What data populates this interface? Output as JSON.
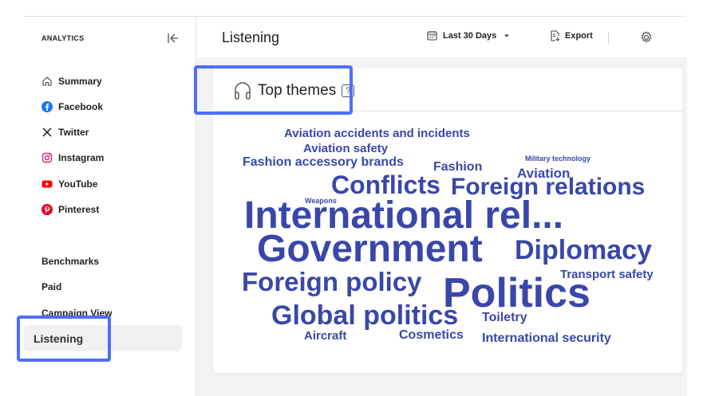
{
  "sidebar": {
    "title": "ANALYTICS",
    "items": [
      {
        "label": "Summary",
        "icon": "home-icon"
      },
      {
        "label": "Facebook",
        "icon": "facebook-icon"
      },
      {
        "label": "Twitter",
        "icon": "x-twitter-icon"
      },
      {
        "label": "Instagram",
        "icon": "instagram-icon"
      },
      {
        "label": "YouTube",
        "icon": "youtube-icon"
      },
      {
        "label": "Pinterest",
        "icon": "pinterest-icon"
      }
    ],
    "sections": [
      "Benchmarks",
      "Paid",
      "Campaign View"
    ],
    "active": "Listening"
  },
  "header": {
    "title": "Listening",
    "date_range": "Last 30 Days",
    "export": "Export"
  },
  "card": {
    "title": "Top themes",
    "help": "?"
  },
  "word_cloud": [
    "Aviation accidents and incidents",
    "Aviation safety",
    "Fashion accessory brands",
    "Fashion",
    "Military technology",
    "Aviation",
    "Conflicts",
    "Foreign relations",
    "Weapons",
    "International rel...",
    "Government",
    "Diplomacy",
    "Foreign policy",
    "Politics",
    "Transport safety",
    "Global politics",
    "Toiletry",
    "Aircraft",
    "Cosmetics",
    "International security"
  ],
  "colors": {
    "word_cloud": "#3a47a8",
    "highlight": "#4f6ef7",
    "facebook": "#1877f2",
    "instagram": "#d62976",
    "youtube": "#ff0000",
    "pinterest": "#e60023"
  }
}
